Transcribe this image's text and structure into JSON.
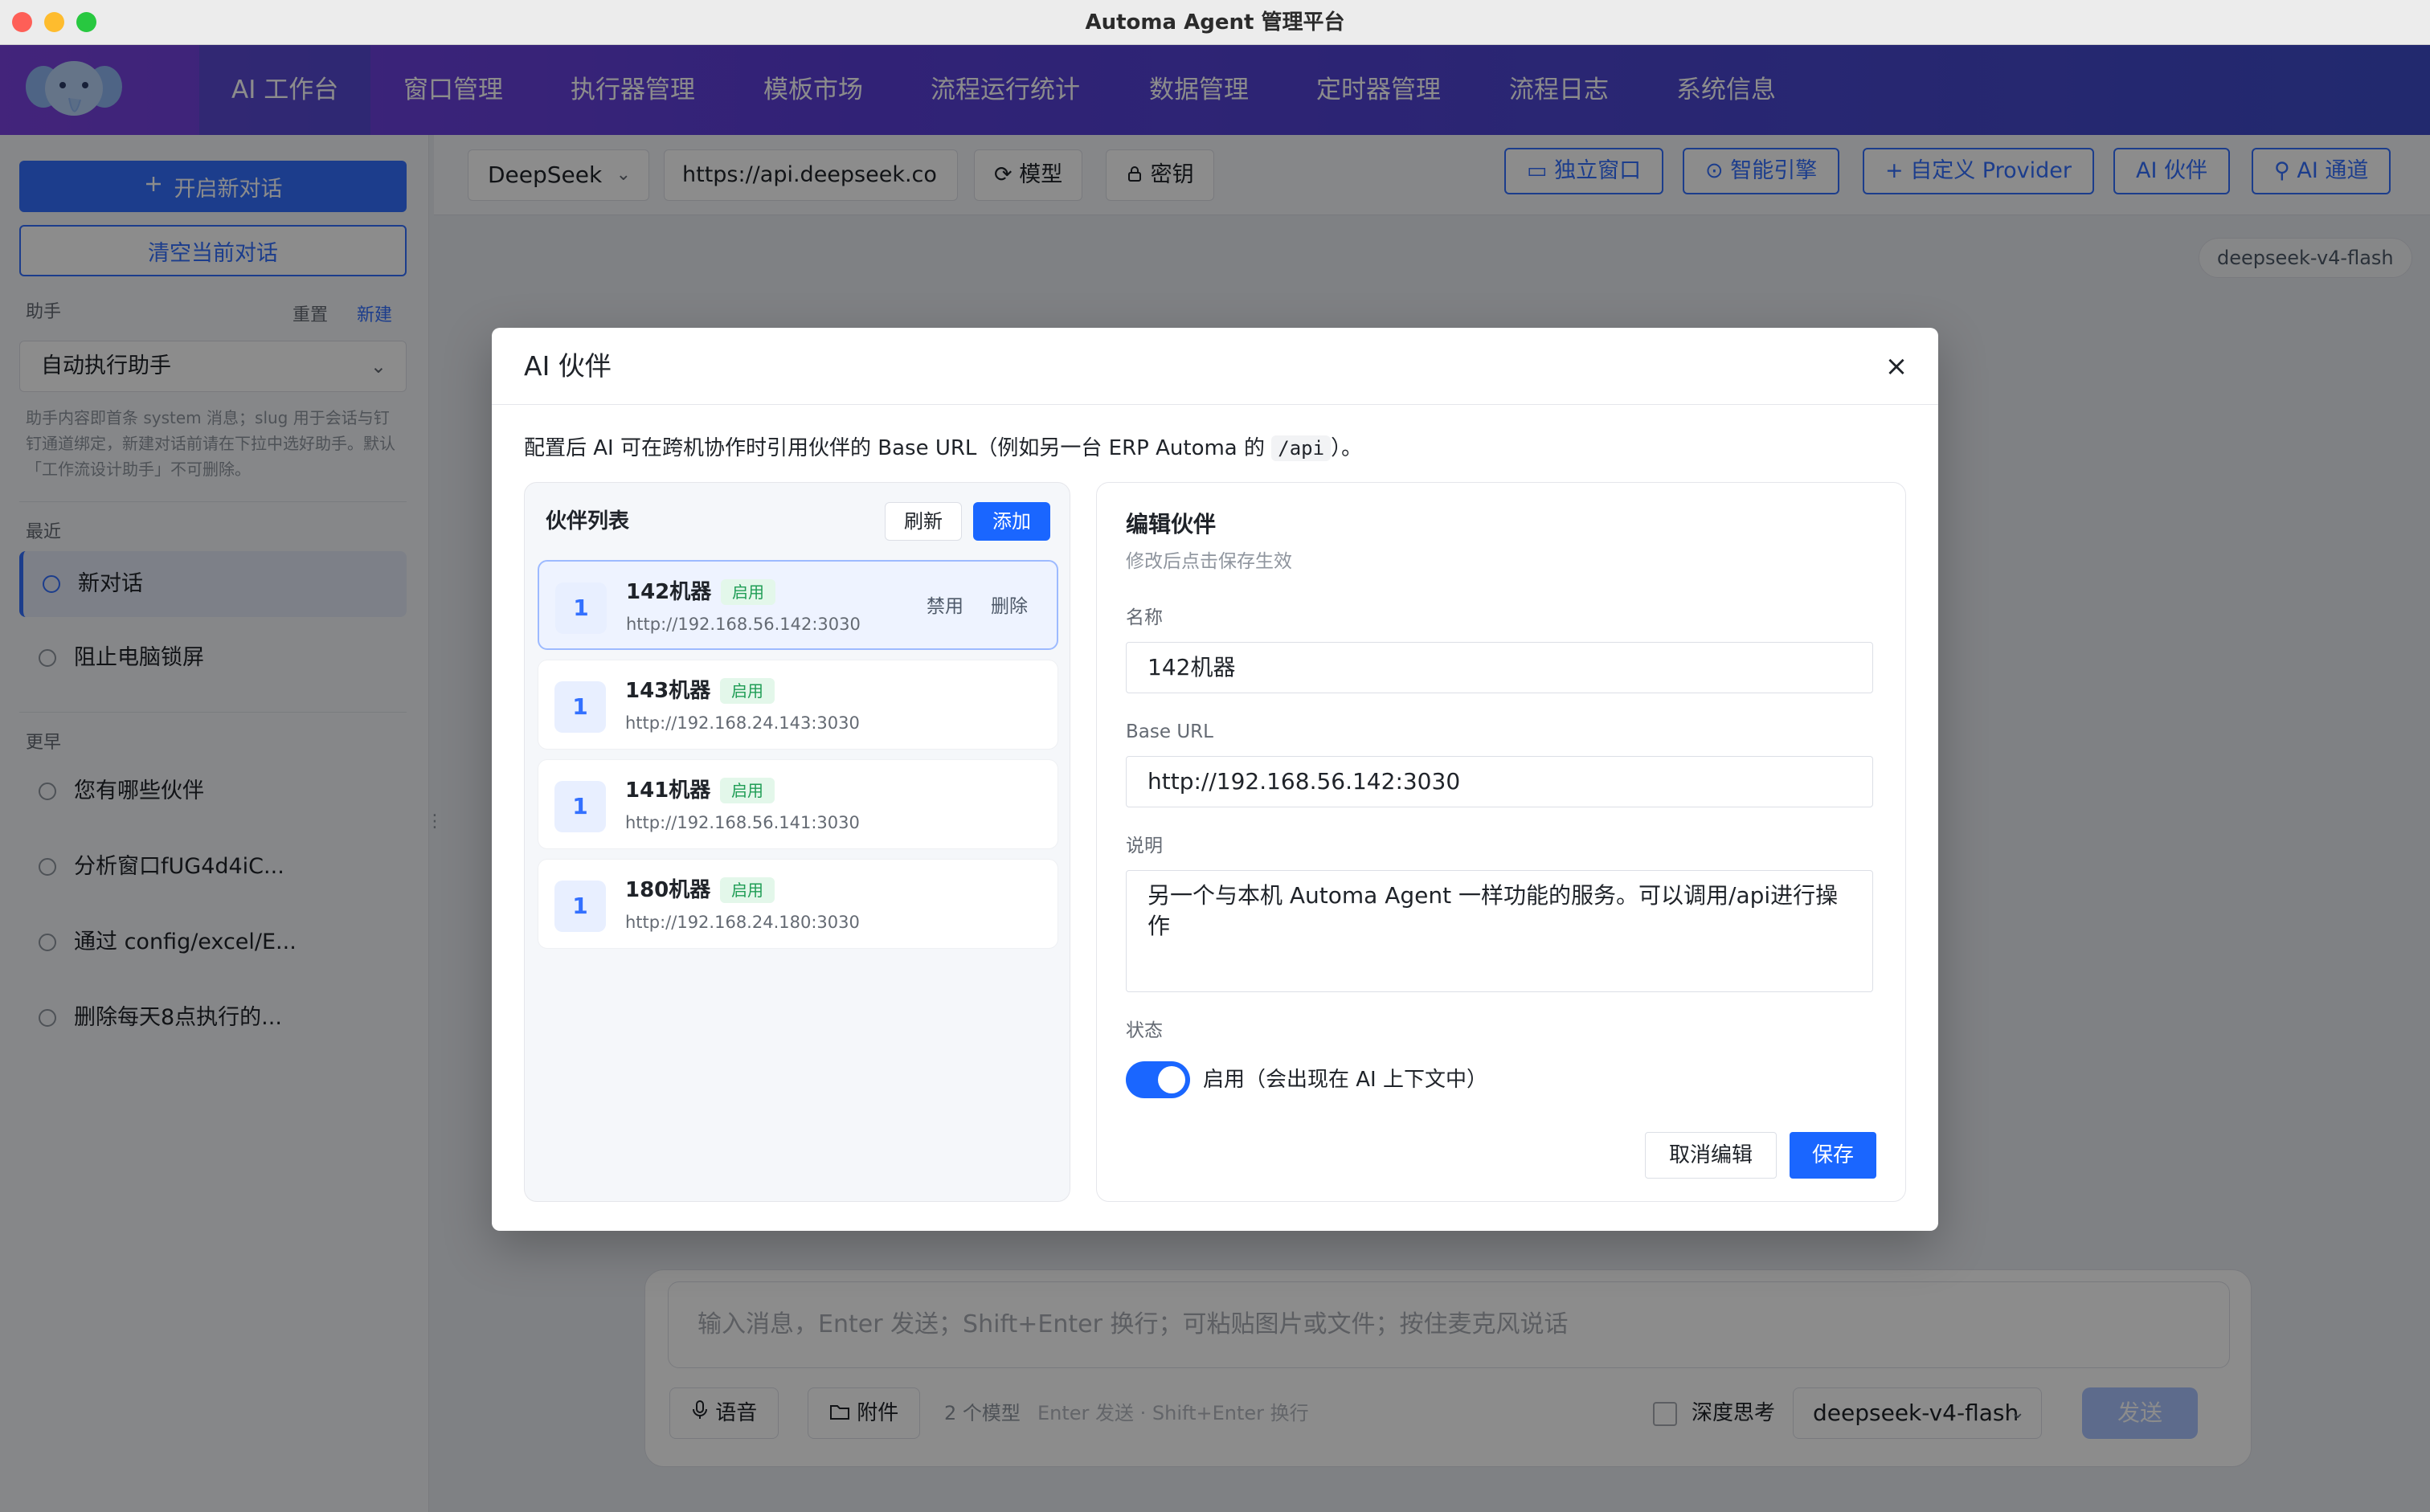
{
  "window": {
    "title": "Automa Agent 管理平台"
  },
  "nav": {
    "items": [
      {
        "label": "AI 工作台"
      },
      {
        "label": "窗口管理"
      },
      {
        "label": "执行器管理"
      },
      {
        "label": "模板市场"
      },
      {
        "label": "流程运行统计"
      },
      {
        "label": "数据管理"
      },
      {
        "label": "定时器管理"
      },
      {
        "label": "流程日志"
      },
      {
        "label": "系统信息"
      }
    ],
    "active_index": 0
  },
  "sidebar": {
    "new_chat_label": "开启新对话",
    "clear_chat_label": "清空当前对话",
    "assistant_label": "助手",
    "reset_label": "重置",
    "create_label": "新建",
    "assistant_selected": "自动执行助手",
    "assistant_hint": "助手内容即首条 system 消息；slug 用于会话与钉钉通道绑定，新建对话前请在下拉中选好助手。默认「工作流设计助手」不可删除。",
    "recent_label": "最近",
    "recent_items": [
      {
        "label": "新对话"
      },
      {
        "label": "阻止电脑锁屏"
      }
    ],
    "earlier_label": "更早",
    "earlier_items": [
      {
        "label": "您有哪些伙伴"
      },
      {
        "label": "分析窗口fUG4d4iC..."
      },
      {
        "label": "通过 config/excel/E..."
      },
      {
        "label": "删除每天8点执行的..."
      }
    ]
  },
  "toolbar": {
    "provider_selected": "DeepSeek",
    "base_url": "https://api.deepseek.co",
    "models_label": "模型",
    "key_label": "密钥",
    "standalone_window_label": "独立窗口",
    "smart_engine_label": "智能引擎",
    "custom_provider_label": "自定义 Provider",
    "ai_partner_label": "AI 伙伴",
    "ai_channel_label": "AI 通道"
  },
  "chat": {
    "model_tag": "deepseek-v4-flash"
  },
  "composer": {
    "placeholder": "输入消息，Enter 发送；Shift+Enter 换行；可粘贴图片或文件；按住麦克风说话",
    "voice_label": "语音",
    "attach_label": "附件",
    "model_count": "2 个模型",
    "shortcut_hint": "Enter 发送 · Shift+Enter 换行",
    "deep_think_label": "深度思考",
    "model_selected": "deepseek-v4-flash",
    "send_label": "发送"
  },
  "modal": {
    "title": "AI 伙伴",
    "desc_before": "配置后 AI 可在跨机协作时引用伙伴的 Base URL（例如另一台 ERP Automa 的 ",
    "desc_code": "/api",
    "desc_after": "）。",
    "list": {
      "title": "伙伴列表",
      "refresh_label": "刷新",
      "add_label": "添加",
      "disable_label": "禁用",
      "delete_label": "删除",
      "partners": [
        {
          "num": "1",
          "name": "142机器",
          "status": "启用",
          "url": "http://192.168.56.142:3030"
        },
        {
          "num": "1",
          "name": "143机器",
          "status": "启用",
          "url": "http://192.168.24.143:3030"
        },
        {
          "num": "1",
          "name": "141机器",
          "status": "启用",
          "url": "http://192.168.56.141:3030"
        },
        {
          "num": "1",
          "name": "180机器",
          "status": "启用",
          "url": "http://192.168.24.180:3030"
        }
      ]
    },
    "edit": {
      "title": "编辑伙伴",
      "subtitle": "修改后点击保存生效",
      "name_label": "名称",
      "name_value": "142机器",
      "base_url_label": "Base URL",
      "base_url_value": "http://192.168.56.142:3030",
      "desc_label": "说明",
      "desc_value": "另一个与本机 Automa Agent 一样功能的服务。可以调用/api进行操作",
      "status_label": "状态",
      "status_toggle_label": "启用（会出现在 AI 上下文中）",
      "cancel_label": "取消编辑",
      "save_label": "保存"
    }
  }
}
